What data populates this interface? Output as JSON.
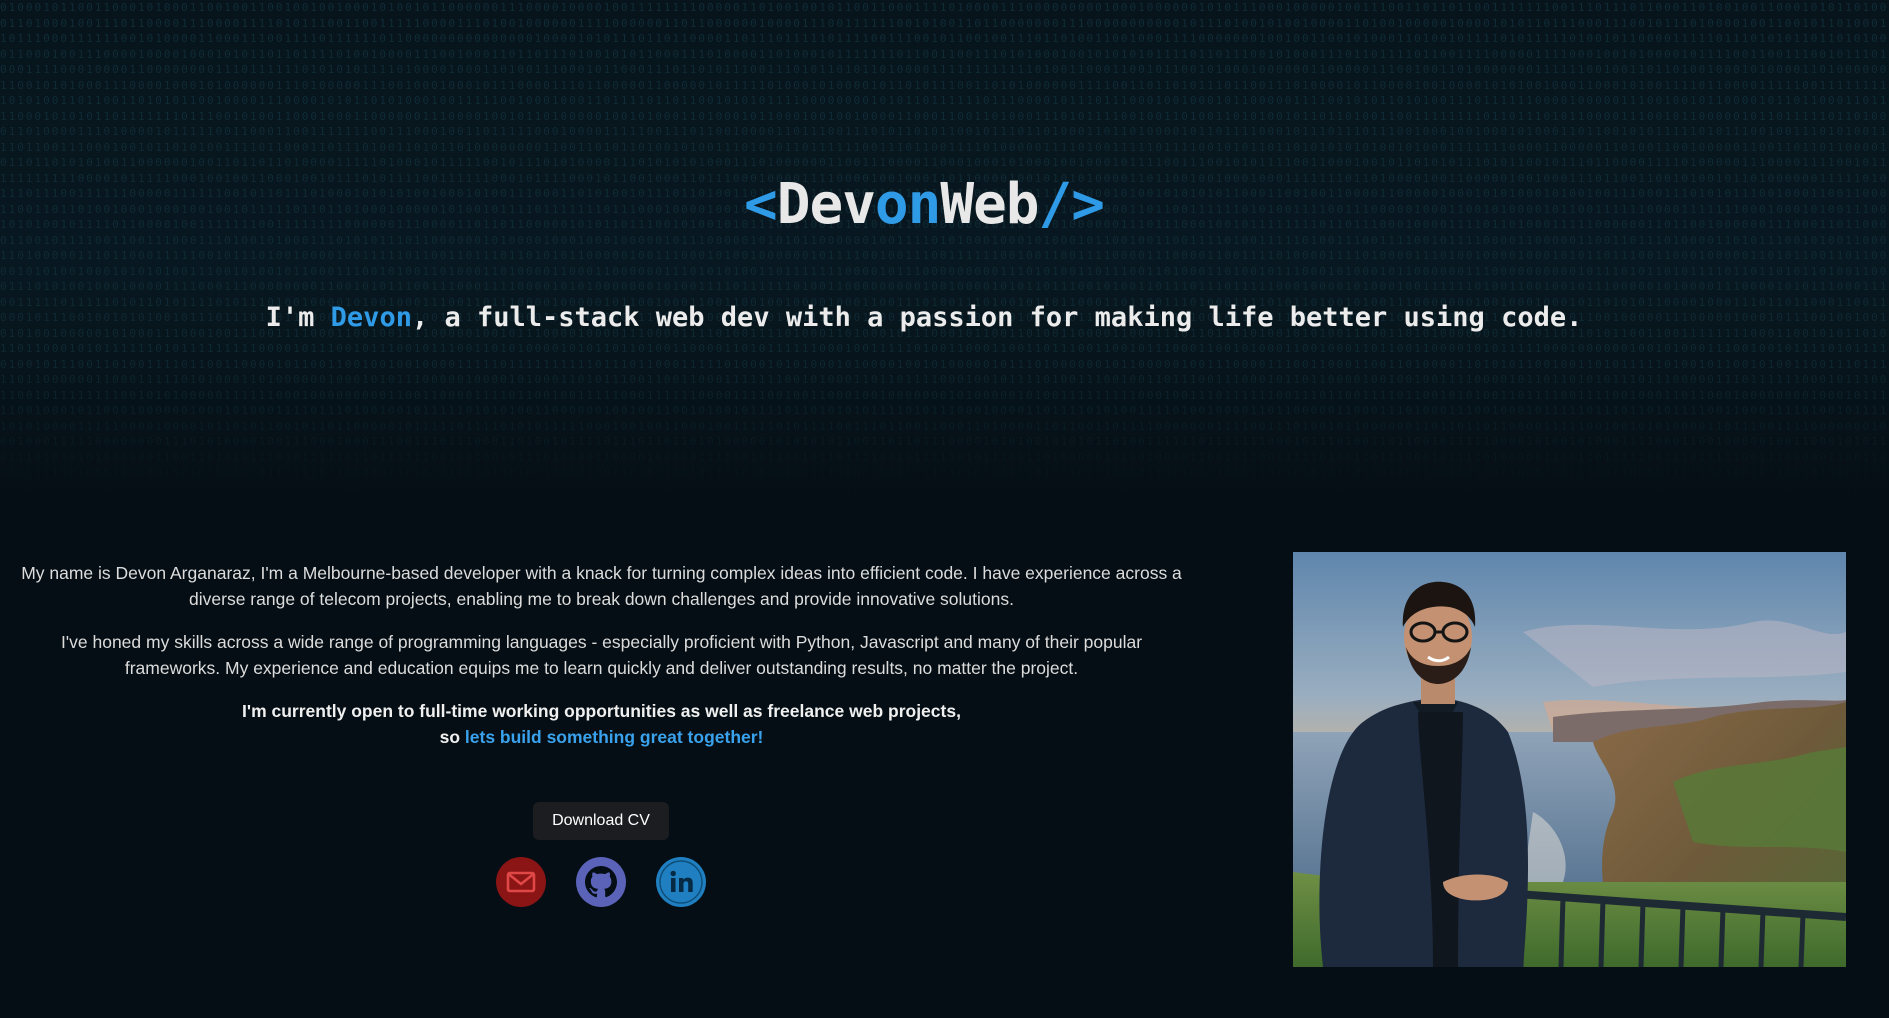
{
  "brand": {
    "open": "<",
    "part1": "Dev",
    "part2": "on",
    "part3": "Web",
    "close": "/>"
  },
  "tagline": {
    "prefix": "I'm ",
    "name": "Devon",
    "suffix": ", a full-stack web dev with a passion for making life better using code."
  },
  "about": {
    "paragraph1": "My name is Devon Arganaraz, I'm a Melbourne-based developer with a knack for turning complex ideas into efficient code. I have experience across a diverse range of telecom projects, enabling me to break down challenges and provide innovative solutions.",
    "paragraph2": "I've honed my skills across a wide range of programming languages - especially proficient with Python, Javascript and many of their popular frameworks. My experience and education equips me to learn quickly and deliver outstanding results, no matter the project.",
    "availability": "I'm currently open to full-time working opportunities as well as freelance web projects,",
    "cta_prefix": "so ",
    "cta_link": "lets build something great together!"
  },
  "download_cv_label": "Download CV",
  "social": [
    {
      "icon": "email-icon",
      "color": "#8b1414"
    },
    {
      "icon": "github-icon",
      "color": "#5a63b8"
    },
    {
      "icon": "linkedin-icon",
      "color": "#1f7fc0"
    }
  ],
  "colors": {
    "accent": "#2f9ae6",
    "background": "#050e14",
    "button": "#1b1d21"
  }
}
